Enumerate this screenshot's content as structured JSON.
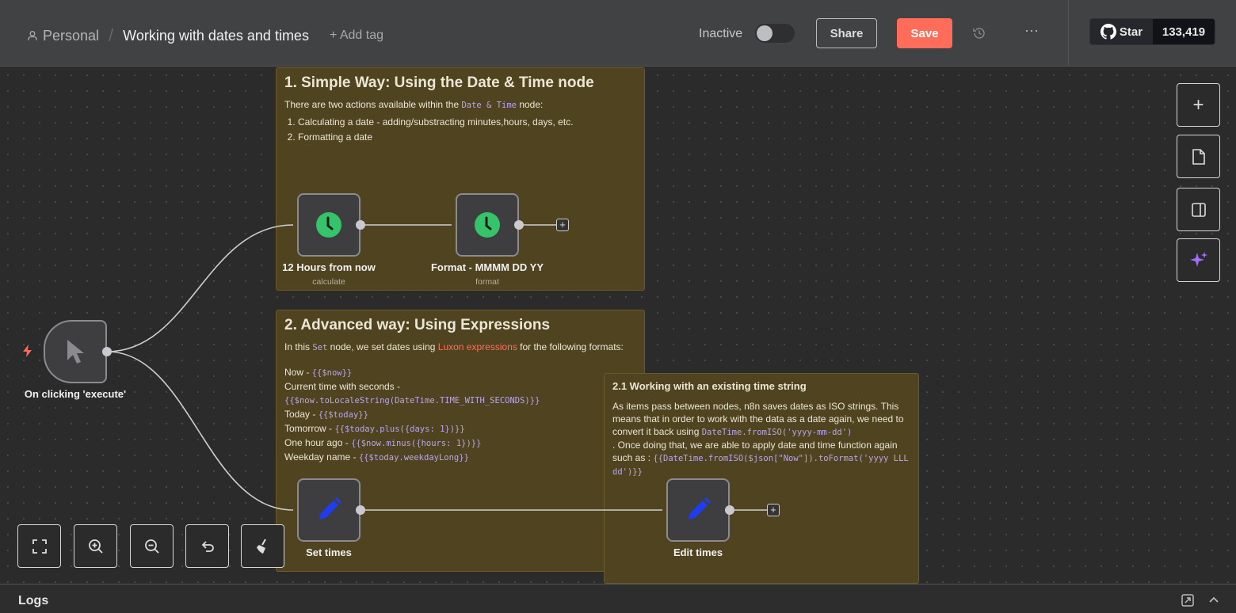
{
  "header": {
    "project": "Personal",
    "workflow_title": "Working with dates and times",
    "add_tag": "+ Add tag",
    "status": "Inactive",
    "active": false,
    "share": "Share",
    "save": "Save",
    "github_star": "Star",
    "github_count": "133,419",
    "accent": "#ff6d5a"
  },
  "notes": [
    {
      "title": "1. Simple Way: Using the Date & Time node",
      "intro_pre": "There are two actions available within the ",
      "intro_code": "Date & Time",
      "intro_post": " node:",
      "items": [
        "Calculating a date - adding/substracting minutes,hours, days, etc.",
        "Formatting a date"
      ]
    },
    {
      "title": "2. Advanced way: Using Expressions",
      "intro_pre": "In this ",
      "intro_code": "Set",
      "intro_mid": " node, we set dates using ",
      "intro_link": "Luxon expressions",
      "intro_post": " for the following formats:",
      "lines": [
        {
          "label": "Now - ",
          "code": "{{$now}}"
        },
        {
          "label": "Current time with seconds - ",
          "code": "{{$now.toLocaleString(DateTime.TIME_WITH_SECONDS)}}"
        },
        {
          "label": "Today - ",
          "code": "{{$today}}"
        },
        {
          "label": "Tomorrow - ",
          "code": "{{$today.plus({days: 1})}}"
        },
        {
          "label": "One hour ago - ",
          "code": "{{$now.minus({hours: 1})}}"
        },
        {
          "label": "Weekday name - ",
          "code": "{{$today.weekdayLong}}"
        }
      ]
    },
    {
      "title": "2.1 Working with an existing time string",
      "p1": "As items pass between nodes, n8n saves dates as ISO strings. This means that in order to work with the data as a date again, we need to convert it back using ",
      "code1": "DateTime.fromISO('yyyy-mm-dd')",
      "p2": ". Once doing that, we are able to apply date and time function again such as : ",
      "code2": "{{DateTime.fromISO($json[\"Now\"]).toFormat('yyyy LLL dd')}}"
    }
  ],
  "nodes": [
    {
      "name": "On clicking 'execute'",
      "icon": "cursor-icon"
    },
    {
      "name": "12 Hours from now",
      "sub": "calculate",
      "icon": "clock-icon"
    },
    {
      "name": "Format - MMMM DD YY",
      "sub": "format",
      "icon": "clock-icon"
    },
    {
      "name": "Set times",
      "icon": "pencil-icon"
    },
    {
      "name": "Edit times",
      "icon": "pencil-icon"
    }
  ],
  "logs": {
    "label": "Logs"
  }
}
